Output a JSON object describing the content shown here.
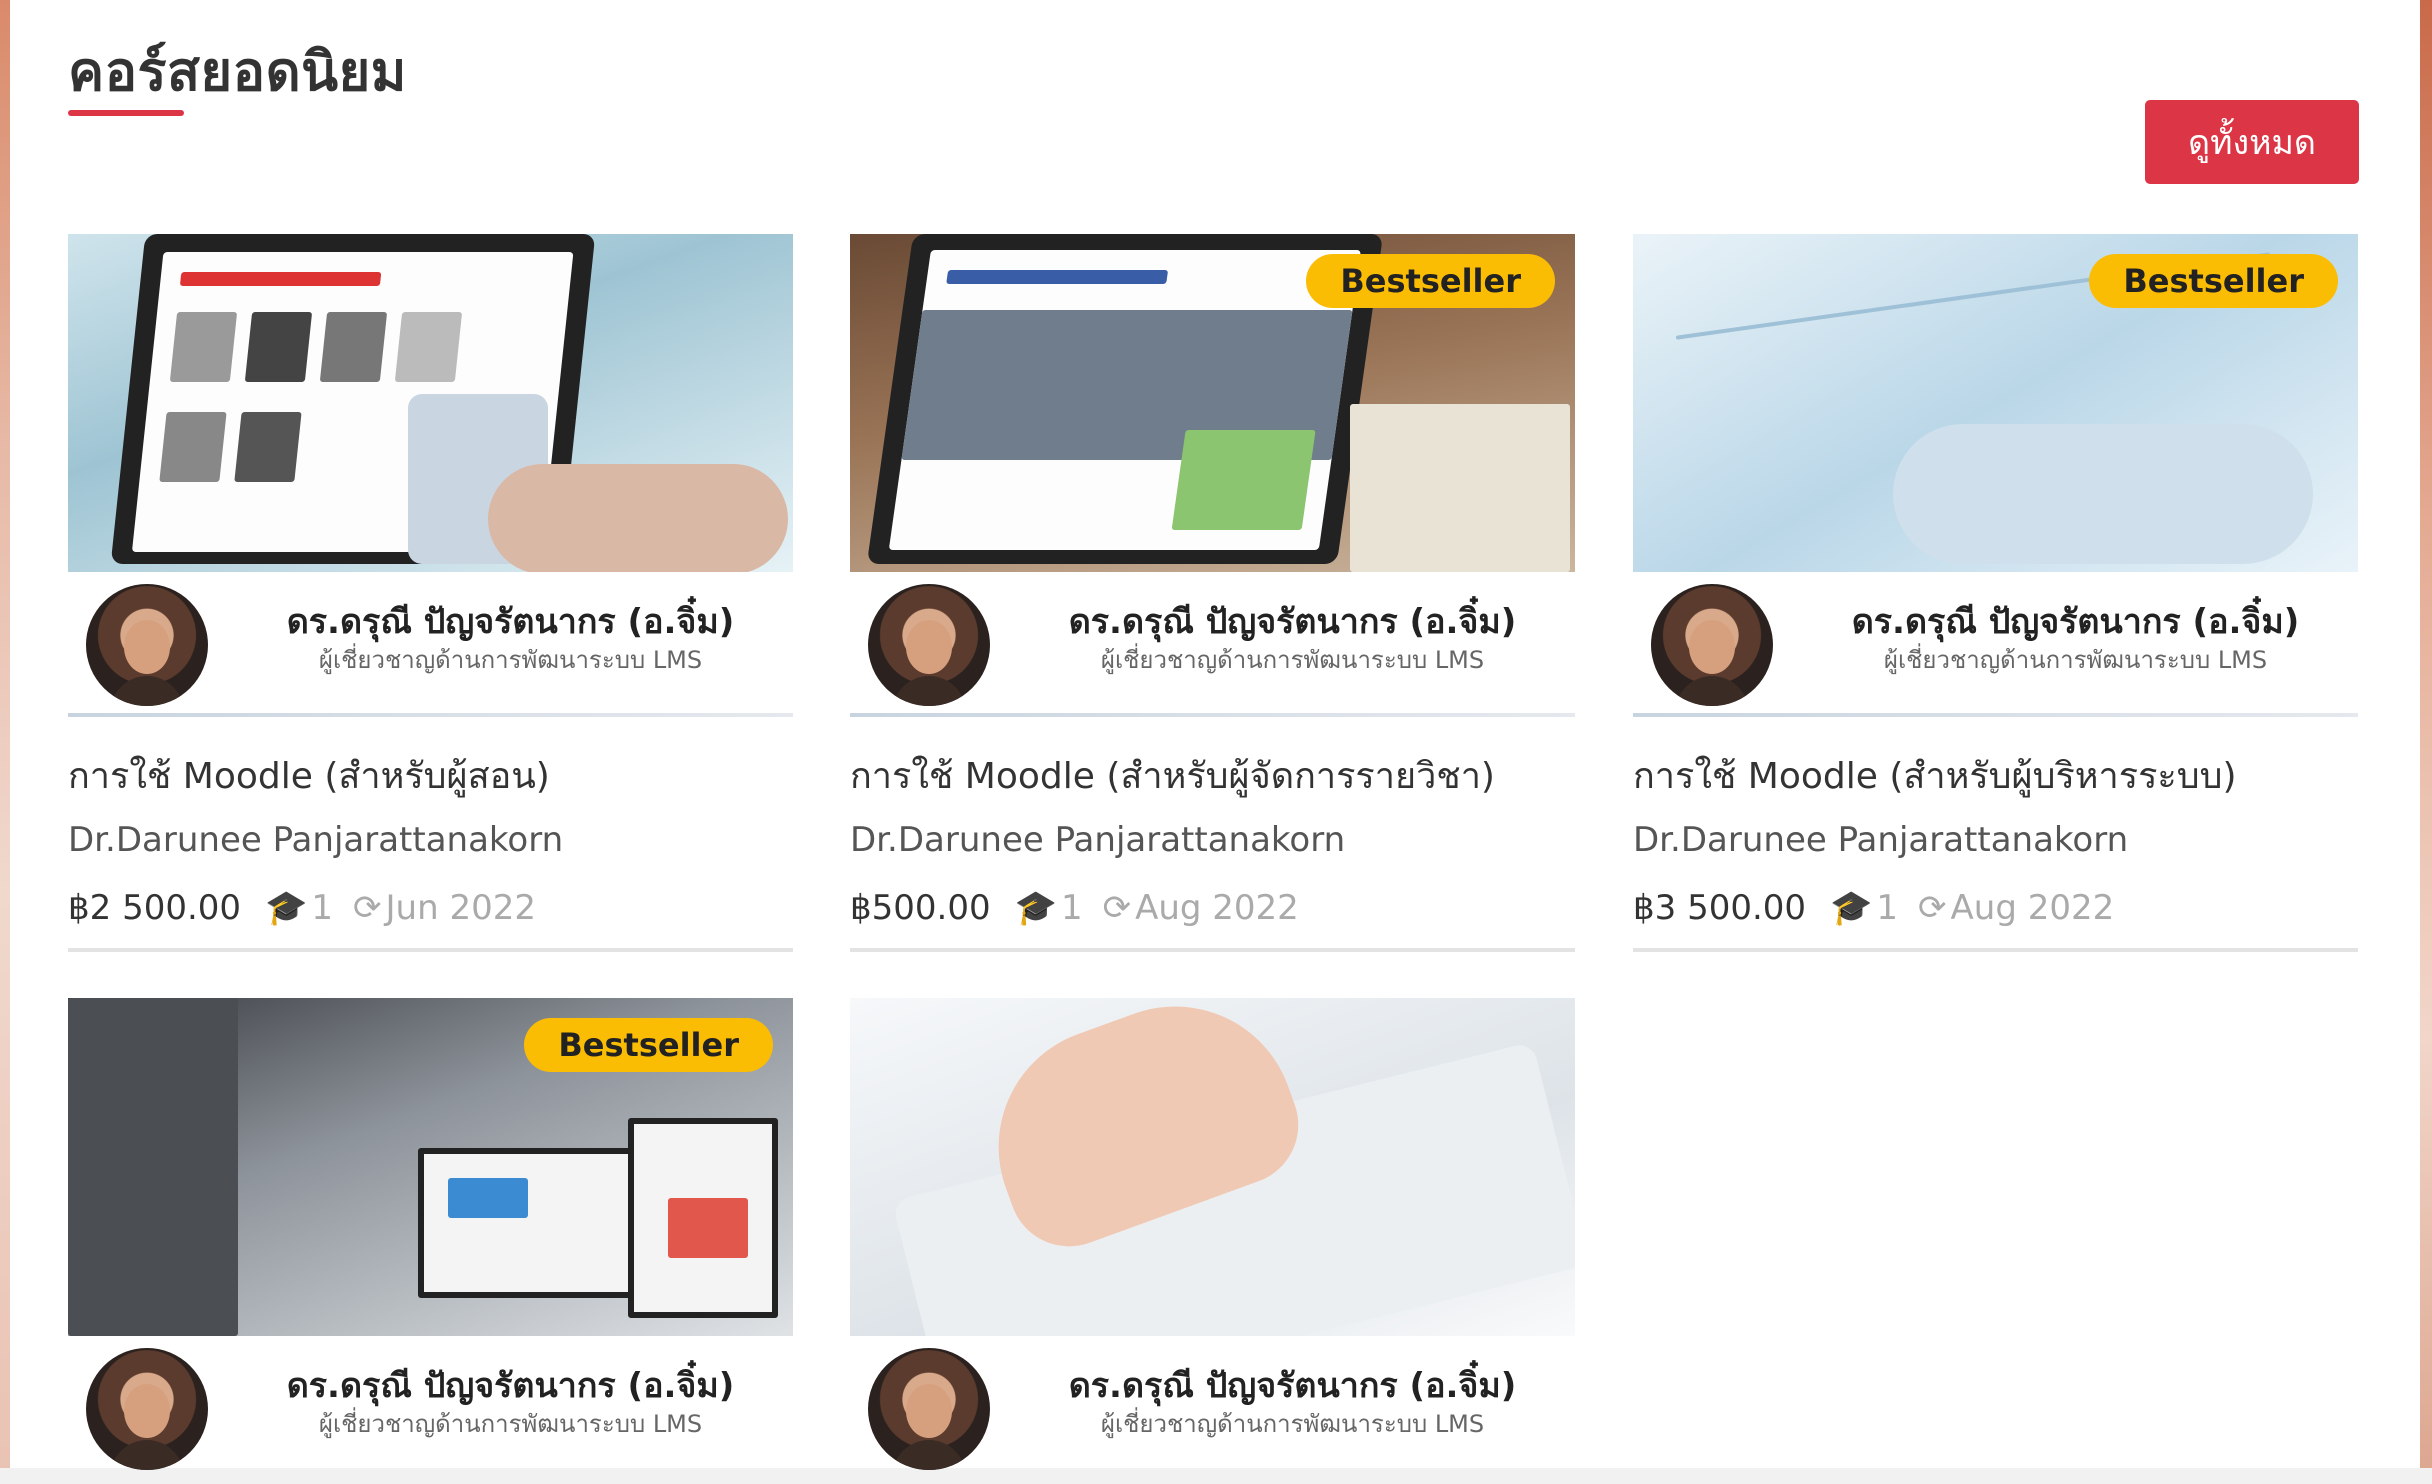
{
  "section": {
    "title": "คอร์สยอดนิยม",
    "view_all_label": "ดูทั้งหมด"
  },
  "colors": {
    "accent": "#dc3545",
    "badge": "#fbbc04"
  },
  "courses": [
    {
      "badge": "",
      "instructor_name": "ดร.ดรุณี ปัญจรัตนากร (อ.จิ๋ม)",
      "instructor_role": "ผู้เชี่ยวชาญด้านการพัฒนาระบบ LMS",
      "title": "การใช้ Moodle (สำหรับผู้สอน)",
      "author": "Dr.Darunee Panjarattanakorn",
      "price": "฿2 500.00",
      "students": "1",
      "updated": "Jun 2022"
    },
    {
      "badge": "Bestseller",
      "instructor_name": "ดร.ดรุณี ปัญจรัตนากร (อ.จิ๋ม)",
      "instructor_role": "ผู้เชี่ยวชาญด้านการพัฒนาระบบ LMS",
      "title": "การใช้ Moodle (สำหรับผู้จัดการรายวิชา)",
      "author": "Dr.Darunee Panjarattanakorn",
      "price": "฿500.00",
      "students": "1",
      "updated": "Aug 2022"
    },
    {
      "badge": "Bestseller",
      "instructor_name": "ดร.ดรุณี ปัญจรัตนากร (อ.จิ๋ม)",
      "instructor_role": "ผู้เชี่ยวชาญด้านการพัฒนาระบบ LMS",
      "title": "การใช้ Moodle (สำหรับผู้บริหารระบบ)",
      "author": "Dr.Darunee Panjarattanakorn",
      "price": "฿3 500.00",
      "students": "1",
      "updated": "Aug 2022"
    },
    {
      "badge": "Bestseller",
      "instructor_name": "ดร.ดรุณี ปัญจรัตนากร (อ.จิ๋ม)",
      "instructor_role": "ผู้เชี่ยวชาญด้านการพัฒนาระบบ LMS"
    },
    {
      "badge": "",
      "instructor_name": "ดร.ดรุณี ปัญจรัตนากร (อ.จิ๋ม)",
      "instructor_role": "ผู้เชี่ยวชาญด้านการพัฒนาระบบ LMS"
    }
  ]
}
